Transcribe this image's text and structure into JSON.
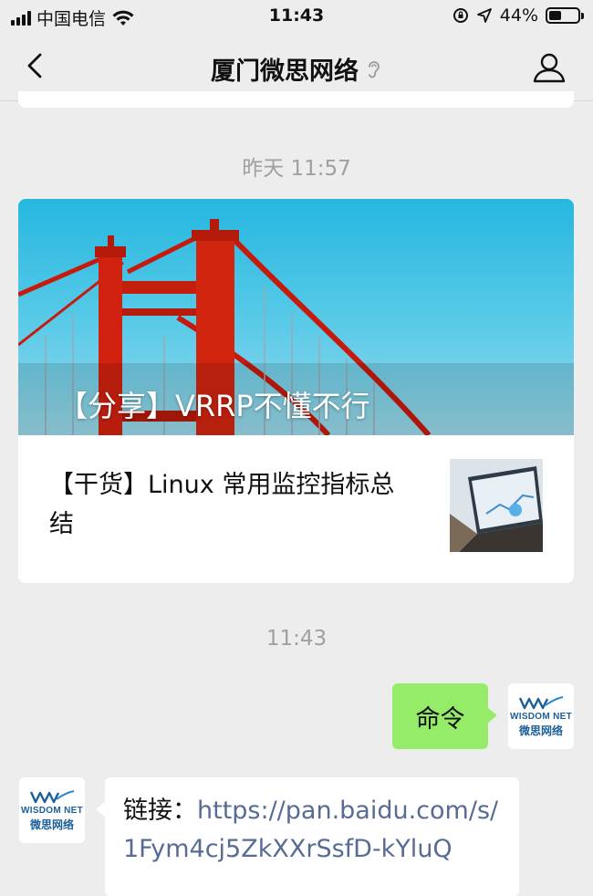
{
  "status": {
    "carrier": "中国电信",
    "time": "11:43",
    "battery": "44%",
    "battery_level": 0.44
  },
  "nav": {
    "title": "厦门微思网络",
    "back_icon": "chevron-left-icon",
    "ear_icon": "ear-icon",
    "profile_icon": "person-icon"
  },
  "chat": {
    "timestamp_1": "昨天 11:57",
    "article": {
      "main_title": "【分享】VRRP不懂不行",
      "sub_title": "【干货】Linux 常用监控指标总结"
    },
    "timestamp_2": "11:43",
    "sent_message": "命令",
    "received_prefix": "链接：",
    "received_link": "https://pan.baidu.com/s/1Fym4cj5ZkXXrSsfD-kYluQ"
  },
  "avatar": {
    "brand_en": "WISDOM NET",
    "brand_cn": "微思网络"
  },
  "colors": {
    "background": "#ededed",
    "sent_bubble": "#95ec69",
    "link": "#576b95",
    "timestamp": "#a0a0a0"
  }
}
